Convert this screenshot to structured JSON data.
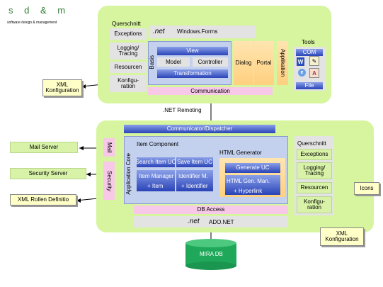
{
  "logo": {
    "line1": "s d & m",
    "line2": "software design & management"
  },
  "top": {
    "querschnitt": "Querschnitt",
    "exceptions": "Exceptions",
    "logging": "Logging/\nTracing",
    "resourcen": "Resourcen",
    "konfiguration": "Konfigu-\nration",
    "net_logo": ".net",
    "windows_forms": "Windows.Forms",
    "basis": "Basis",
    "view": "View",
    "model": "Model",
    "controller": "Controller",
    "transformation": "Transformation",
    "dialog": "Dialog",
    "portal": "Portal",
    "applikation": "Applikation",
    "tools": "Tools",
    "com": "COM",
    "file": "File",
    "communication": "Communication"
  },
  "remoting": ".NET Remoting",
  "bottom": {
    "dispatcher": "Communicator/Dispatcher",
    "mail": "Mail",
    "security": "Security",
    "application_core": "Application Core",
    "item_component": "Item Component",
    "search_item_uc": "Search Item UC",
    "save_item_uc": "Save Item UC",
    "item_manager": "Item Manager",
    "item": "+ Item",
    "identifier_m": "Identifier M.",
    "identifier": "+ Identifier",
    "html_generator": "HTML Generator",
    "generate_uc": "Generate UC",
    "html_gen_man": "HTML Gen. Man.",
    "hyperlink": "+ Hyperlink",
    "db_access": "DB Access",
    "net_logo": ".net",
    "ado_net": "ADO.NET",
    "querschnitt": "Querschnitt",
    "exceptions": "Exceptions",
    "logging": "Logging/\nTracing",
    "resourcen": "Resourcen",
    "konfiguration": "Konfigu-\nration"
  },
  "external": {
    "xml_konfig_top": "XML\nKonfiguration",
    "mail_server": "Mail Server",
    "security_server": "Security Server",
    "xml_rollen": "XML Rollen Definitio",
    "icons": "Icons",
    "xml_konfig_bottom": "XML\nKonfiguration",
    "mira_db": "MIRA DB"
  },
  "colors": {
    "container": "#d6f59e",
    "panel": "#e3e3e3",
    "navy_bar": "#2a44b8",
    "note": "#ffffc8",
    "db": "#1fa85a"
  }
}
